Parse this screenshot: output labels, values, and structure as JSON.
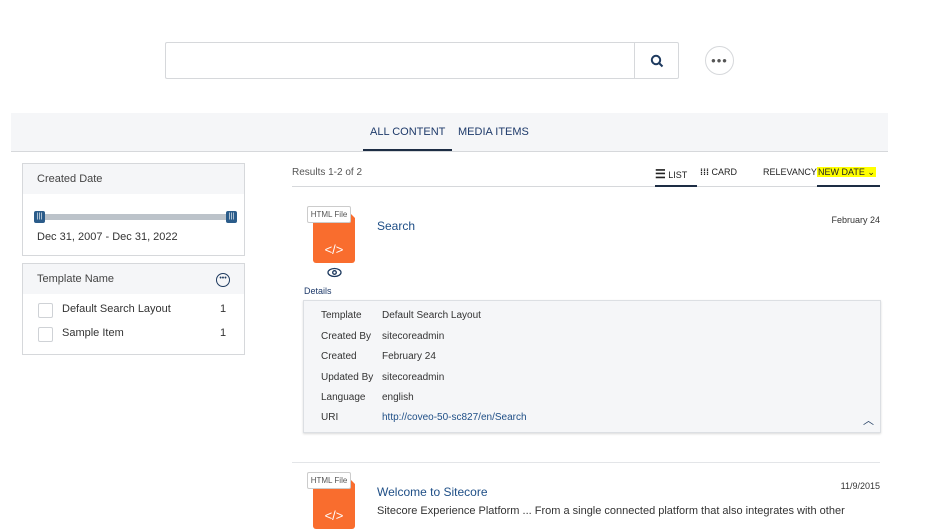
{
  "search": {
    "placeholder": "",
    "value": ""
  },
  "tabs": [
    {
      "label": "ALL CONTENT",
      "active": true
    },
    {
      "label": "MEDIA ITEMS",
      "active": false
    }
  ],
  "facets": {
    "created_date": {
      "title": "Created Date",
      "range": "Dec 31, 2007 - Dec 31, 2022"
    },
    "template_name": {
      "title": "Template Name",
      "items": [
        {
          "label": "Default Search Layout",
          "count": "1"
        },
        {
          "label": "Sample Item",
          "count": "1"
        }
      ]
    }
  },
  "results_summary": "Results 1-2 of 2",
  "layout": {
    "list": "LIST",
    "card": "CARD"
  },
  "sort": {
    "relevancy": "RELEVANCY",
    "new_date": "NEW DATE",
    "highlight": "#ffff00"
  },
  "results": [
    {
      "type": "HTML File",
      "title": "Search",
      "date": "February 24",
      "details_link": "Details",
      "details": [
        {
          "label": "Template",
          "value": "Default Search Layout"
        },
        {
          "label": "Created By",
          "value": "sitecoreadmin"
        },
        {
          "label": "Created",
          "value": "February 24"
        },
        {
          "label": "Updated By",
          "value": "sitecoreadmin"
        },
        {
          "label": "Language",
          "value": "english"
        },
        {
          "label": "URI",
          "value": "http://coveo-50-sc827/en/Search"
        }
      ]
    },
    {
      "type": "HTML File",
      "title": "Welcome to Sitecore",
      "date": "11/9/2015",
      "excerpt": "Sitecore Experience Platform ... From a single connected platform that also integrates with other"
    }
  ],
  "icon_glyph": "</>",
  "colors": {
    "accent": "#1e4e86",
    "file": "#f96d2e",
    "slider": "#2b5c8a"
  }
}
